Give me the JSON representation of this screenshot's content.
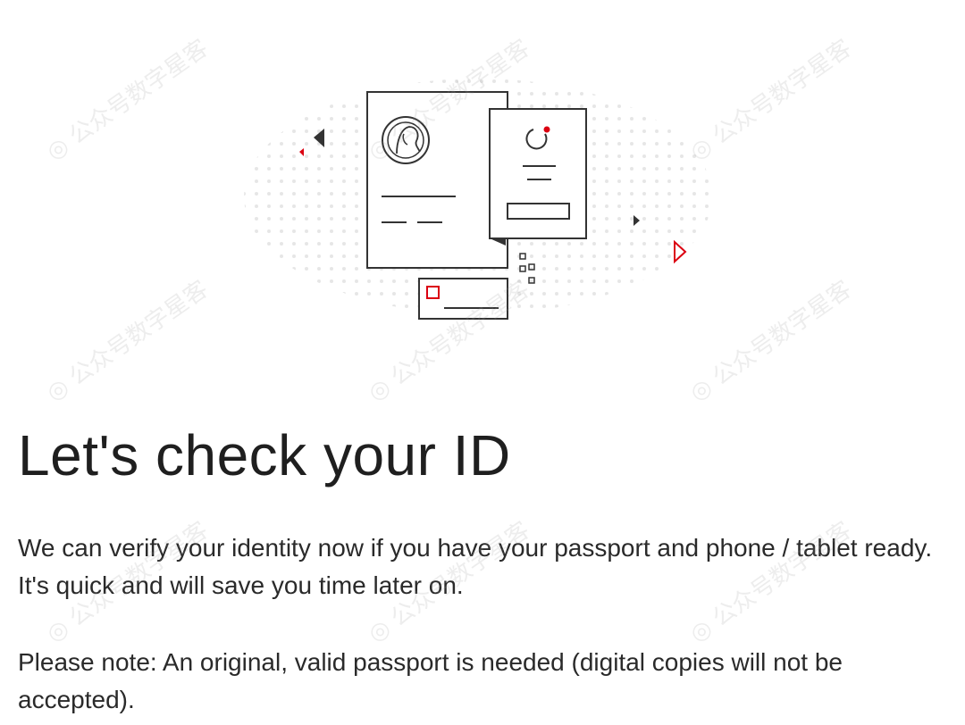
{
  "page": {
    "title": "Let's check your ID",
    "intro": "We can verify your identity now if you have your passport and phone / tablet ready. It's quick and will save you time later on.",
    "note": "Please note: An original, valid passport is needed (digital copies will not be accepted)."
  },
  "illustration": {
    "icon": "id-documents-illustration",
    "accent_color": "#db0011",
    "line_color": "#333333",
    "dot_color": "#e6e6e6"
  },
  "watermark": {
    "text": "公众号数字星客",
    "icon": "at-sign-watermark-icon"
  }
}
